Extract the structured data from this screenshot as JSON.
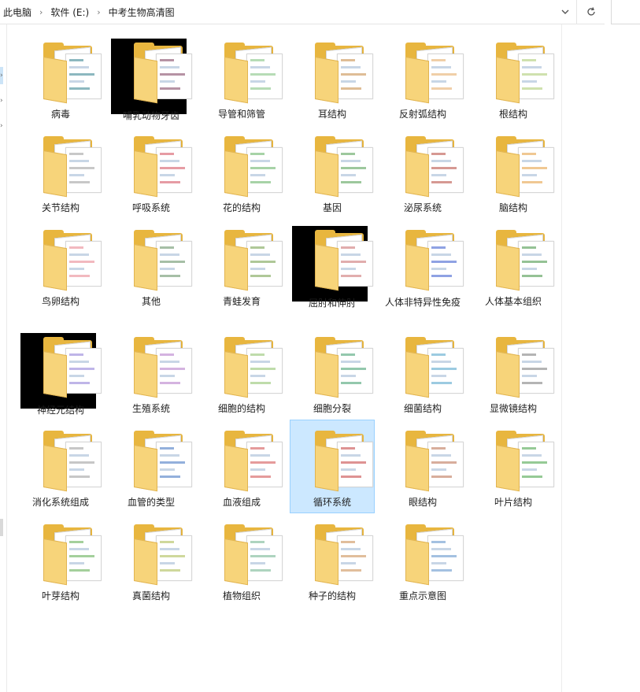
{
  "address": {
    "path": [
      "此电脑",
      "软件 (E:)",
      "中考生物高清图"
    ],
    "dropdown_icon": "chevron-down-icon",
    "refresh_icon": "refresh-icon"
  },
  "folders": [
    {
      "name": "病毒",
      "color": "#2e7d8a"
    },
    {
      "name": "哺乳动物牙齿",
      "color": "#7a3b5a"
    },
    {
      "name": "导管和筛管",
      "color": "#7bbf7a"
    },
    {
      "name": "耳结构",
      "color": "#c4863f"
    },
    {
      "name": "反射弧结构",
      "color": "#e3a860"
    },
    {
      "name": "根结构",
      "color": "#a8c86b"
    },
    {
      "name": "关节结构",
      "color": "#9b9b9b"
    },
    {
      "name": "呼吸系统",
      "color": "#d24b5a"
    },
    {
      "name": "花的结构",
      "color": "#5fae5f"
    },
    {
      "name": "基因",
      "color": "#4c9b4c"
    },
    {
      "name": "泌尿系统",
      "color": "#b5453a"
    },
    {
      "name": "脑结构",
      "color": "#e39b3a"
    },
    {
      "name": "鸟卵结构",
      "color": "#e7808a"
    },
    {
      "name": "其他",
      "color": "#5c8a5c"
    },
    {
      "name": "青蛙发育",
      "color": "#6e9b44"
    },
    {
      "name": "屈肘和伸肘",
      "color": "#c96a6a"
    },
    {
      "name": "人体非特异性免疫",
      "color": "#3355cc"
    },
    {
      "name": "人体基本组织",
      "color": "#3e8f3e"
    },
    {
      "name": "神经元结构",
      "color": "#8a79d6"
    },
    {
      "name": "生殖系统",
      "color": "#b074c7"
    },
    {
      "name": "细胞的结构",
      "color": "#8bbf66"
    },
    {
      "name": "细胞分裂",
      "color": "#3b9a6a"
    },
    {
      "name": "细菌结构",
      "color": "#4aa0c8"
    },
    {
      "name": "显微镜结构",
      "color": "#777777"
    },
    {
      "name": "消化系统组成",
      "color": "#999999"
    },
    {
      "name": "血管的类型",
      "color": "#3b70c0"
    },
    {
      "name": "血液组成",
      "color": "#d04848"
    },
    {
      "name": "循环系统",
      "color": "#c23b3b"
    },
    {
      "name": "眼结构",
      "color": "#b86b4a"
    },
    {
      "name": "叶片结构",
      "color": "#3f9f3f"
    },
    {
      "name": "叶芽结构",
      "color": "#5aaa4a"
    },
    {
      "name": "真菌结构",
      "color": "#a7b84a"
    },
    {
      "name": "植物组织",
      "color": "#6bb08a"
    },
    {
      "name": "种子的结构",
      "color": "#c9894a"
    },
    {
      "name": "重点示意图",
      "color": "#5a8ec9"
    }
  ],
  "selected_folder": "循环系统",
  "colors": {
    "selection": "#cce8ff",
    "selection_border": "#99d1ff",
    "folder": "#e8b63f"
  }
}
